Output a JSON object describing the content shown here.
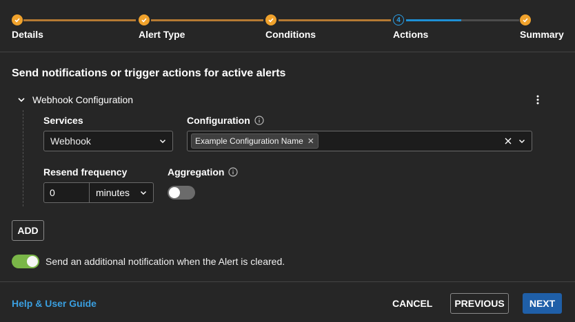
{
  "stepper": {
    "steps": [
      {
        "label": "Details",
        "state": "complete"
      },
      {
        "label": "Alert Type",
        "state": "complete"
      },
      {
        "label": "Conditions",
        "state": "complete"
      },
      {
        "label": "Actions",
        "state": "current",
        "number": "4"
      },
      {
        "label": "Summary",
        "state": "complete"
      }
    ],
    "colors": {
      "complete": "#f0a22c",
      "current": "#2aa0e8"
    }
  },
  "heading": "Send notifications or trigger actions for active alerts",
  "section": {
    "title": "Webhook Configuration",
    "services": {
      "label": "Services",
      "value": "Webhook"
    },
    "configuration": {
      "label": "Configuration",
      "chip": "Example Configuration Name"
    },
    "resend": {
      "label": "Resend frequency",
      "value": "0",
      "unit": "minutes"
    },
    "aggregation": {
      "label": "Aggregation",
      "enabled": false
    }
  },
  "add_button": "ADD",
  "cleared_notification": {
    "text": "Send an additional notification when the Alert is cleared.",
    "enabled": true
  },
  "footer": {
    "help_link": "Help & User Guide",
    "cancel": "CANCEL",
    "previous": "PREVIOUS",
    "next": "NEXT"
  }
}
